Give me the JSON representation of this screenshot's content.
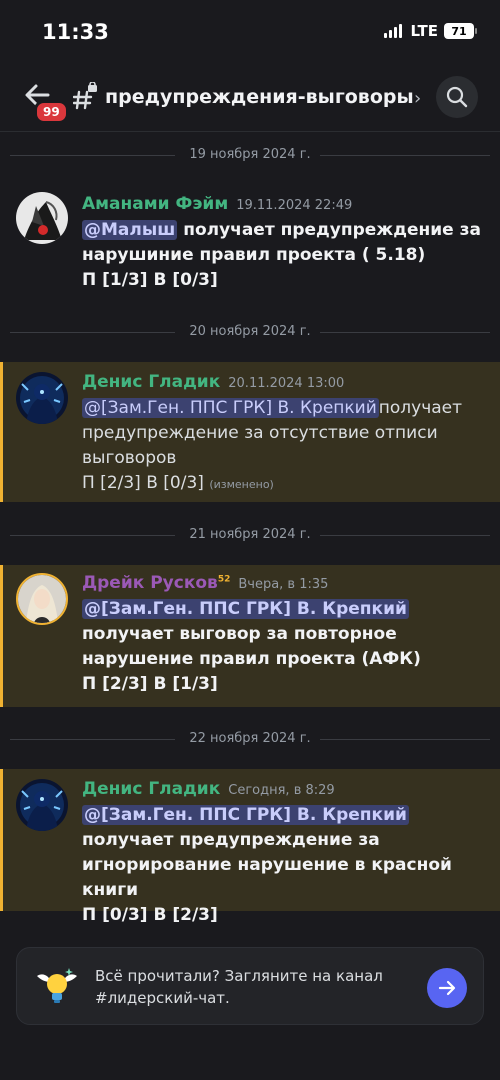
{
  "status_bar": {
    "time": "11:33",
    "network": "LTE",
    "battery": "71"
  },
  "header": {
    "unread_badge": "99",
    "channel_name": "предупреждения-выговоры",
    "chevron": "›"
  },
  "icons": {
    "back": "arrow-left-icon",
    "channel": "locked-hash-icon",
    "search": "search-icon",
    "send": "arrow-right-icon"
  },
  "colors": {
    "background": "#1a1a1e",
    "highlight_bg": "#36311f",
    "highlight_border": "#f0b232",
    "mention_bg": "#3c4270",
    "green_name": "#43b581",
    "purple_name": "#9b59b6",
    "accent": "#5865f2"
  },
  "dividers": [
    "19 ноября 2024 г.",
    "20 ноября 2024 г.",
    "21 ноября 2024 г.",
    "22 ноября 2024 г."
  ],
  "messages": [
    {
      "author": "Аманами Фэйм",
      "timestamp": "19.11.2024 22:49",
      "mention": "@Малыш",
      "text": " получает предупреждение за нарушиние правил проекта ( 5.18)",
      "line2": "П [1/3] В [0/3]"
    },
    {
      "author": "Денис Гладик",
      "timestamp": "20.11.2024 13:00",
      "mention": "@[Зам.Ген. ППС ГРК] В. Крепкий",
      "text": "получает предупреждение за отсутствие отписи выговоров",
      "line2": "П [2/3] В [0/3]",
      "edited": "(изменено)"
    },
    {
      "author": "Дрейк Русков",
      "author_sup": "52",
      "timestamp": "Вчера, в 1:35",
      "mention": "@[Зам.Ген. ППС ГРК] В. Крепкий",
      "text": " получает выговор за повторное нарушение правил проекта (АФК)",
      "line2": "П [2/3] В [1/3]"
    },
    {
      "author": "Денис Гладик",
      "timestamp": "Сегодня, в 8:29",
      "mention": "@[Зам.Ген. ППС ГРК] В. Крепкий",
      "text": " получает предупреждение за  игнорирование нарушение в  красной книги",
      "line2": "П [0/3] В [2/3]"
    }
  ],
  "bottom_prompt": {
    "text": "Всё прочитали? Загляните на канал #лидерский-чат."
  }
}
